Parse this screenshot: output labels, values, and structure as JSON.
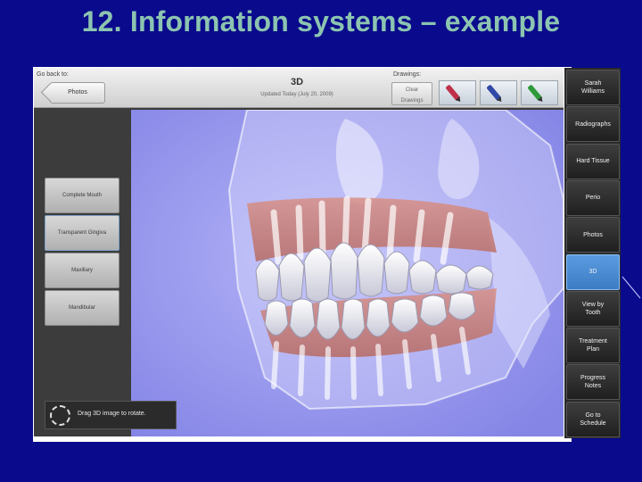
{
  "slide": {
    "title": "12. Information systems – example"
  },
  "topbar": {
    "go_back_label": "Go back to:",
    "back_button": "Photos",
    "view_title": "3D",
    "view_subtitle": "Updated Today (July 20, 2009)",
    "drawings_label": "Drawings:",
    "clear_drawings_line1": "Clear",
    "clear_drawings_line2": "Drawings",
    "pens": [
      {
        "name": "red-pen-icon",
        "color": "#c0304a"
      },
      {
        "name": "blue-pen-icon",
        "color": "#3048a8"
      },
      {
        "name": "green-pen-icon",
        "color": "#2f9a3a"
      }
    ]
  },
  "left_options": [
    "Complete Mouth",
    "Transparent Gingiva",
    "Maxillary",
    "Mandibular"
  ],
  "selected_option_index": 1,
  "hint": {
    "text": "Drag 3D image to rotate."
  },
  "right_nav": [
    {
      "line1": "Sarah",
      "line2": "Williams"
    },
    {
      "line1": "Radiographs",
      "line2": ""
    },
    {
      "line1": "Hard Tissue",
      "line2": ""
    },
    {
      "line1": "Perio",
      "line2": ""
    },
    {
      "line1": "Photos",
      "line2": ""
    },
    {
      "line1": "3D",
      "line2": ""
    },
    {
      "line1": "View by",
      "line2": "Tooth"
    },
    {
      "line1": "Treatment",
      "line2": "Plan"
    },
    {
      "line1": "Progress",
      "line2": "Notes"
    },
    {
      "line1": "Go to",
      "line2": "Schedule"
    }
  ],
  "active_nav_index": 5,
  "colors": {
    "slide_background": "#0a0a8c",
    "title_color": "#8cc4b0",
    "nav_active": "#4d8fd6",
    "viewport_background": "#9a9af0",
    "gum": "#c97a6e"
  }
}
